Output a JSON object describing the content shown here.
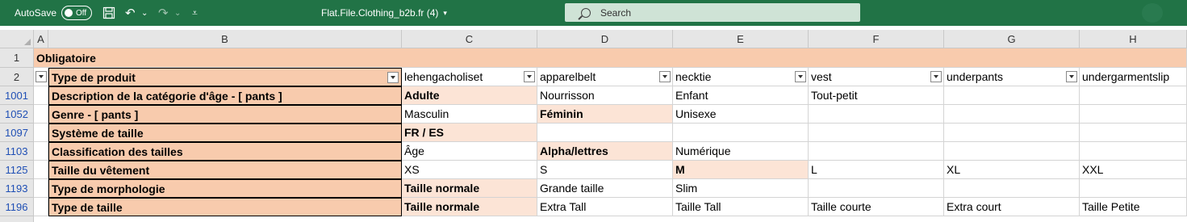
{
  "titlebar": {
    "autosave_label": "AutoSave",
    "autosave_state": "Off",
    "filename": "Flat.File.Clothing_b2b.fr (4)",
    "filename_caret": "▾",
    "search_placeholder": "Search",
    "accent_color": "#217346"
  },
  "columns": [
    "A",
    "B",
    "C",
    "D",
    "E",
    "F",
    "G",
    "H"
  ],
  "rows": [
    "1",
    "2",
    "1001",
    "1052",
    "1097",
    "1103",
    "1125",
    "1193",
    "1196"
  ],
  "sheet": {
    "r1": {
      "B": "Obligatoire"
    },
    "r2": {
      "B": "Type de produit",
      "C": "lehengacholiset",
      "D": "apparelbelt",
      "E": "necktie",
      "F": "vest",
      "G": "underpants",
      "H": "undergarmentslip"
    },
    "r1001": {
      "B": "Description de la catégorie d'âge - [ pants ]",
      "C": "Adulte",
      "D": "Nourrisson",
      "E": "Enfant",
      "F": "Tout-petit"
    },
    "r1052": {
      "B": "Genre - [ pants ]",
      "C": "Masculin",
      "D": "Féminin",
      "E": "Unisexe"
    },
    "r1097": {
      "B": "Système de taille",
      "C": "FR / ES"
    },
    "r1103": {
      "B": "Classification des tailles",
      "C": "Âge",
      "D": "Alpha/lettres",
      "E": "Numérique"
    },
    "r1125": {
      "B": "Taille du vêtement",
      "C": "XS",
      "D": "S",
      "E": "M",
      "F": "L",
      "G": "XL",
      "H": "XXL"
    },
    "r1193": {
      "B": "Type de morphologie",
      "C": "Taille normale",
      "D": "Grande taille",
      "E": "Slim"
    },
    "r1196": {
      "B": "Type de taille",
      "C": "Taille normale",
      "D": "Extra Tall",
      "E": "Taille Tall",
      "F": "Taille courte",
      "G": "Extra court",
      "H": "Taille Petite"
    }
  },
  "colors": {
    "header_fill": "#f8cbad",
    "selected_value_fill": "#fce4d6",
    "row_link_color": "#1f4fb5"
  }
}
